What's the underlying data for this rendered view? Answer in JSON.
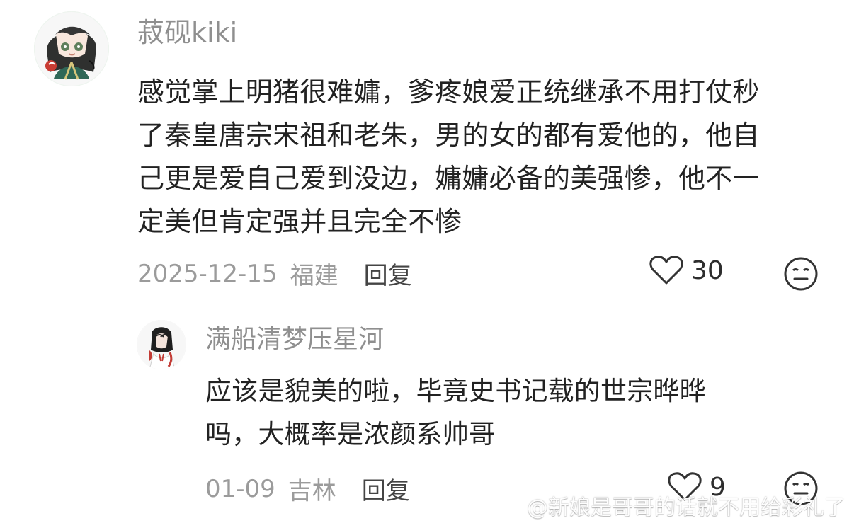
{
  "main_comment": {
    "username": "菽砚kiki",
    "lines": [
      "感觉掌上明猪很难嫞，爹疼娘爱正统继承不用打仗秒",
      "了秦皇唐宗宋祖和老朱，男的女的都有爱他的，他自",
      "己更是爱自己爱到没边，嫞嫞必备的美强惨，他不一",
      "定美但肯定强并且完全不惨"
    ],
    "date": "2025-12-15",
    "location": "福建",
    "reply_label": "回复",
    "likes": "30",
    "avatar_icon": "anime-avatar-icon"
  },
  "reply": {
    "username": "满船清梦压星河",
    "lines": [
      "应该是貌美的啦，毕竟史书记载的世宗晔晔",
      "吗，大概率是浓颜系帅哥"
    ],
    "date": "01-09",
    "location": "吉林",
    "reply_label": "回复",
    "likes": "9",
    "avatar_icon": "ink-style-avatar-icon"
  },
  "watermark": {
    "text": "@新娘是哥哥的话就不用给彩礼了",
    "icon": "weibo-icon"
  },
  "colors": {
    "background": "#ffffff",
    "username": "#8f8f8f",
    "text": "#222222",
    "meta": "#9b9b9b"
  }
}
